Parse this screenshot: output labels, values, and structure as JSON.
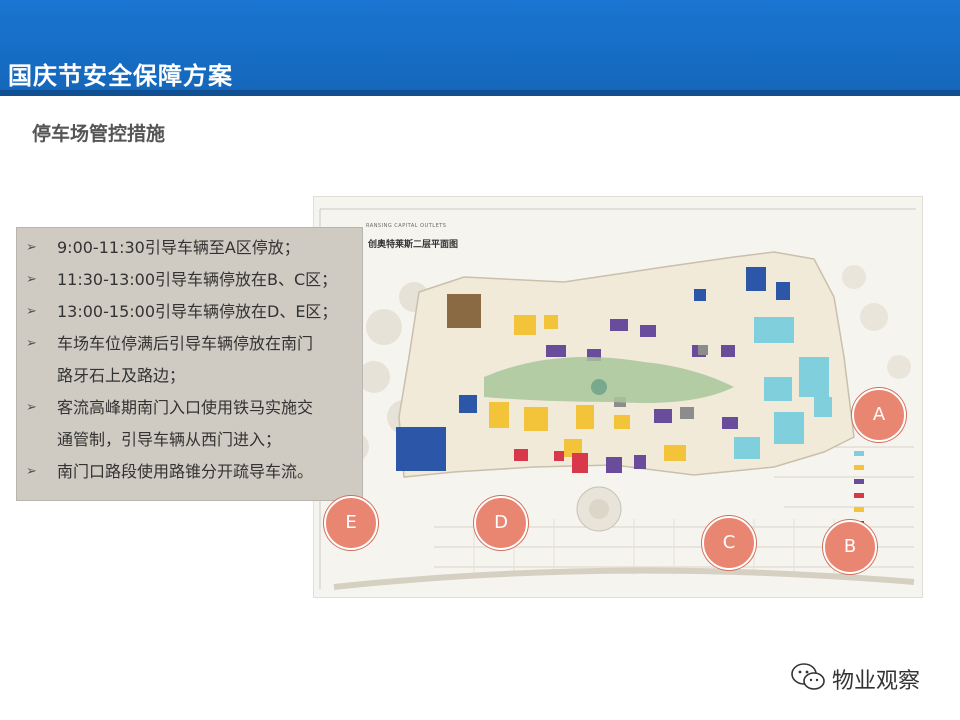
{
  "header": {
    "title": "国庆节安全保障方案"
  },
  "subtitle": "停车场管控措施",
  "map": {
    "title": "创奥特莱斯二层平面图",
    "en_title": "RANSING CAPITAL OUTLETS"
  },
  "measures": [
    {
      "text": "9:00-11:30引导车辆至A区停放；"
    },
    {
      "text": "11:30-13:00引导车辆停放在B、C区；"
    },
    {
      "text": "13:00-15:00引导车辆停放在D、E区；"
    },
    {
      "text": "车场车位停满后引导车辆停放在南门",
      "cont": "路牙石上及路边；"
    },
    {
      "text": "客流高峰期南门入口使用铁马实施交",
      "cont": "通管制，引导车辆从西门进入；"
    },
    {
      "text": "南门口路段使用路锥分开疏导车流。"
    }
  ],
  "zones": {
    "a": "A",
    "b": "B",
    "c": "C",
    "d": "D",
    "e": "E"
  },
  "brand": {
    "name": "物业观察",
    "icon": "wechat-icon"
  },
  "colors": {
    "header": "#1466b9",
    "zone": "#e98672",
    "box": "#cfcac2"
  }
}
